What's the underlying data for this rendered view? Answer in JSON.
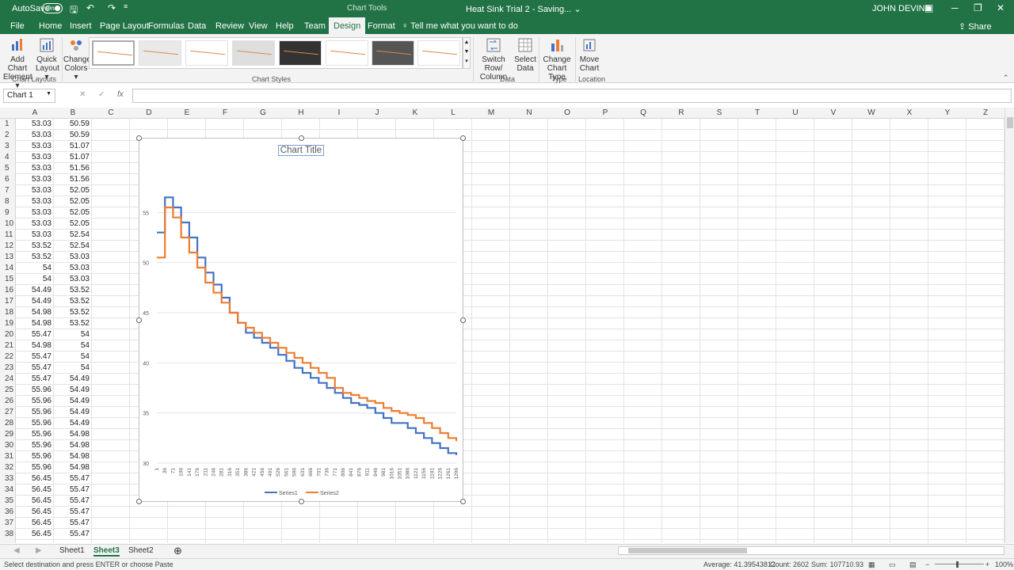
{
  "titlebar": {
    "autosave_label": "AutoSave",
    "autosave_state": "On",
    "doc_title": "Heat Sink Trial 2  -  Saving...  ⌄",
    "context_tab": "Chart Tools",
    "user": "JOHN DEVINE"
  },
  "tabs": [
    "File",
    "Home",
    "Insert",
    "Page Layout",
    "Formulas",
    "Data",
    "Review",
    "View",
    "Help",
    "Team",
    "Design",
    "Format"
  ],
  "active_tab": "Design",
  "tell_me": "Tell me what you want to do",
  "share_label": "Share",
  "ribbon": {
    "add_chart_element": [
      "Add Chart",
      "Element ▾"
    ],
    "quick_layout": [
      "Quick",
      "Layout ▾"
    ],
    "change_colors": [
      "Change",
      "Colors ▾"
    ],
    "switch_row_col": [
      "Switch Row/",
      "Column"
    ],
    "select_data": [
      "Select",
      "Data"
    ],
    "change_chart_type": [
      "Change",
      "Chart Type"
    ],
    "move_chart": [
      "Move",
      "Chart"
    ],
    "groups": {
      "chart_layouts": "Chart Layouts",
      "chart_styles": "Chart Styles",
      "data": "Data",
      "type": "Type",
      "location": "Location"
    }
  },
  "formula_bar": {
    "name_box": "Chart 1",
    "fx": "fx",
    "cancel": "✕",
    "enter": "✓"
  },
  "columns": [
    "A",
    "B",
    "C",
    "D",
    "E",
    "F",
    "G",
    "H",
    "I",
    "J",
    "K",
    "L",
    "M",
    "N",
    "O",
    "P",
    "Q",
    "R",
    "S",
    "T",
    "U",
    "V",
    "W",
    "X",
    "Y",
    "Z"
  ],
  "rows": [
    [
      "1",
      "53.03",
      "50.59"
    ],
    [
      "2",
      "53.03",
      "50.59"
    ],
    [
      "3",
      "53.03",
      "51.07"
    ],
    [
      "4",
      "53.03",
      "51.07"
    ],
    [
      "5",
      "53.03",
      "51.56"
    ],
    [
      "6",
      "53.03",
      "51.56"
    ],
    [
      "7",
      "53.03",
      "52.05"
    ],
    [
      "8",
      "53.03",
      "52.05"
    ],
    [
      "9",
      "53.03",
      "52.05"
    ],
    [
      "10",
      "53.03",
      "52.05"
    ],
    [
      "11",
      "53.03",
      "52.54"
    ],
    [
      "12",
      "53.52",
      "52.54"
    ],
    [
      "13",
      "53.52",
      "53.03"
    ],
    [
      "14",
      "54",
      "53.03"
    ],
    [
      "15",
      "54",
      "53.03"
    ],
    [
      "16",
      "54.49",
      "53.52"
    ],
    [
      "17",
      "54.49",
      "53.52"
    ],
    [
      "18",
      "54.98",
      "53.52"
    ],
    [
      "19",
      "54.98",
      "53.52"
    ],
    [
      "20",
      "55.47",
      "54"
    ],
    [
      "21",
      "54.98",
      "54"
    ],
    [
      "22",
      "55.47",
      "54"
    ],
    [
      "23",
      "55.47",
      "54"
    ],
    [
      "24",
      "55.47",
      "54.49"
    ],
    [
      "25",
      "55.96",
      "54.49"
    ],
    [
      "26",
      "55.96",
      "54.49"
    ],
    [
      "27",
      "55.96",
      "54.49"
    ],
    [
      "28",
      "55.96",
      "54.49"
    ],
    [
      "29",
      "55.96",
      "54.98"
    ],
    [
      "30",
      "55.96",
      "54.98"
    ],
    [
      "31",
      "55.96",
      "54.98"
    ],
    [
      "32",
      "55.96",
      "54.98"
    ],
    [
      "33",
      "56.45",
      "55.47"
    ],
    [
      "34",
      "56.45",
      "55.47"
    ],
    [
      "35",
      "56.45",
      "55.47"
    ],
    [
      "36",
      "56.45",
      "55.47"
    ],
    [
      "37",
      "56.45",
      "55.47"
    ],
    [
      "38",
      "56.45",
      "55.47"
    ]
  ],
  "chart": {
    "title": "Chart Title",
    "y_ticks": [
      "55",
      "50",
      "45",
      "40",
      "35",
      "30"
    ],
    "x_ticks": [
      "1",
      "36",
      "71",
      "106",
      "141",
      "176",
      "211",
      "246",
      "281",
      "316",
      "351",
      "386",
      "421",
      "456",
      "491",
      "526",
      "561",
      "596",
      "631",
      "666",
      "701",
      "736",
      "771",
      "806",
      "841",
      "876",
      "911",
      "946",
      "981",
      "1016",
      "1051",
      "1086",
      "1121",
      "1156",
      "1191",
      "1226",
      "1261",
      "1296"
    ],
    "legend": [
      "Series1",
      "Series2"
    ],
    "colors": {
      "series1": "#4472c4",
      "series2": "#ed7d31"
    }
  },
  "chart_data": {
    "type": "line",
    "title": "Chart Title",
    "xlabel": "",
    "ylabel": "",
    "ylim": [
      30,
      57
    ],
    "grid": true,
    "legend_position": "bottom",
    "x": [
      1,
      36,
      71,
      106,
      141,
      176,
      211,
      246,
      281,
      316,
      351,
      386,
      421,
      456,
      491,
      526,
      561,
      596,
      631,
      666,
      701,
      736,
      771,
      806,
      841,
      876,
      911,
      946,
      981,
      1016,
      1051,
      1086,
      1121,
      1156,
      1191,
      1226,
      1261,
      1296
    ],
    "series": [
      {
        "name": "Series1",
        "values": [
          53,
          56.5,
          55.5,
          54,
          52.5,
          50.5,
          49,
          47.8,
          46.5,
          45,
          44,
          43,
          42.5,
          42,
          41.5,
          40.8,
          40.2,
          39.5,
          39,
          38.5,
          38,
          37.5,
          37,
          36.5,
          36,
          35.8,
          35.5,
          35,
          34.5,
          34,
          34,
          33.5,
          33,
          32.5,
          32,
          31.5,
          31,
          30.8
        ]
      },
      {
        "name": "Series2",
        "values": [
          50.5,
          55.5,
          54.5,
          52.5,
          51,
          49.5,
          48,
          47,
          46,
          45,
          44,
          43.5,
          43,
          42.5,
          42,
          41.5,
          41,
          40.5,
          40,
          39.5,
          39,
          38.5,
          37.5,
          37,
          36.8,
          36.5,
          36.2,
          36,
          35.5,
          35.2,
          35,
          34.8,
          34.5,
          34,
          33.5,
          33,
          32.5,
          32.2
        ]
      }
    ]
  },
  "sheets": [
    "Sheet1",
    "Sheet3",
    "Sheet2"
  ],
  "active_sheet": "Sheet3",
  "status": {
    "message": "Select destination and press ENTER or choose Paste",
    "average": "Average: 41.39543812",
    "count": "Count: 2602",
    "sum": "Sum: 107710.93",
    "zoom": "100%"
  }
}
